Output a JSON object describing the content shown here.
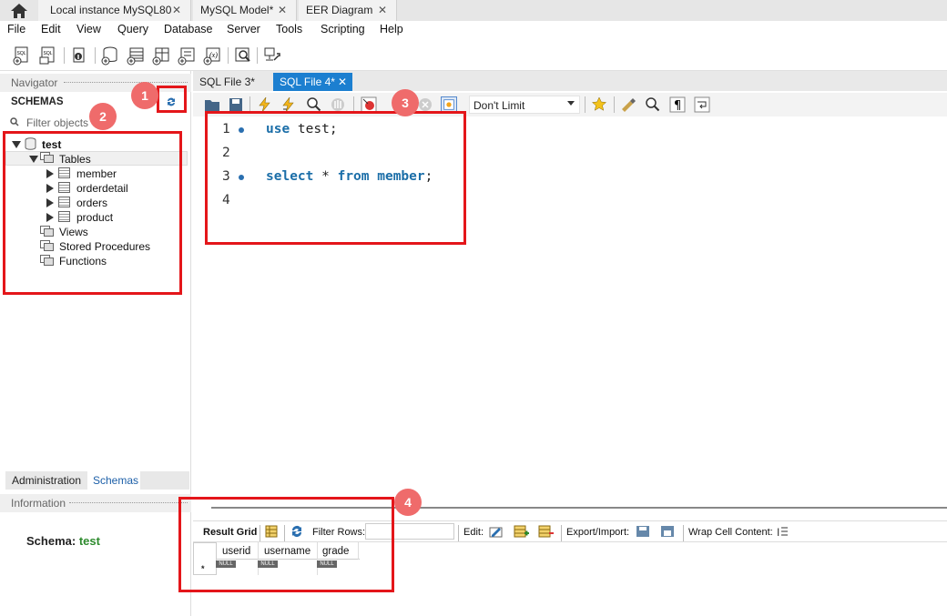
{
  "app_tabs": [
    {
      "label": "Local instance MySQL80"
    },
    {
      "label": "MySQL Model*"
    },
    {
      "label": "EER Diagram"
    }
  ],
  "menu": [
    "File",
    "Edit",
    "View",
    "Query",
    "Database",
    "Server",
    "Tools",
    "Scripting",
    "Help"
  ],
  "navigator": {
    "header": "Navigator",
    "schemas_title": "SCHEMAS",
    "filter_placeholder": "Filter objects",
    "tree": {
      "schema": "test",
      "tables_label": "Tables",
      "tables": [
        "member",
        "orderdetail",
        "orders",
        "product"
      ],
      "views_label": "Views",
      "procs_label": "Stored Procedures",
      "funcs_label": "Functions"
    },
    "bottom_tabs": [
      "Administration",
      "Schemas"
    ]
  },
  "information": {
    "header": "Information",
    "schema_label": "Schema:",
    "schema_value": "test"
  },
  "editor": {
    "tabs": [
      "SQL File 3*",
      "SQL File 4*"
    ],
    "limit_select": "Don't Limit",
    "lines": [
      {
        "num": "1",
        "kw": "use",
        "rest": " test;"
      },
      {
        "num": "2",
        "kw": "",
        "rest": ""
      },
      {
        "num": "3",
        "kw": "select",
        "rest": " * ",
        "kw2": "from",
        "rest2": " member",
        "tail": ";"
      },
      {
        "num": "4",
        "kw": "",
        "rest": ""
      }
    ]
  },
  "result": {
    "result_grid_label": "Result Grid",
    "filter_rows_label": "Filter Rows:",
    "edit_label": "Edit:",
    "export_label": "Export/Import:",
    "wrap_label": "Wrap Cell Content:",
    "columns": [
      "userid",
      "username",
      "grade"
    ],
    "null_text": "NULL",
    "new_row_marker": "*"
  },
  "annotations": [
    "1",
    "2",
    "3",
    "4"
  ],
  "colors": {
    "annotation": "#e4161a",
    "badge": "#ef6b6b",
    "active_tab": "#1c7fd0",
    "keyword": "#1b6ea8",
    "schema_value": "#2e8b2e"
  }
}
